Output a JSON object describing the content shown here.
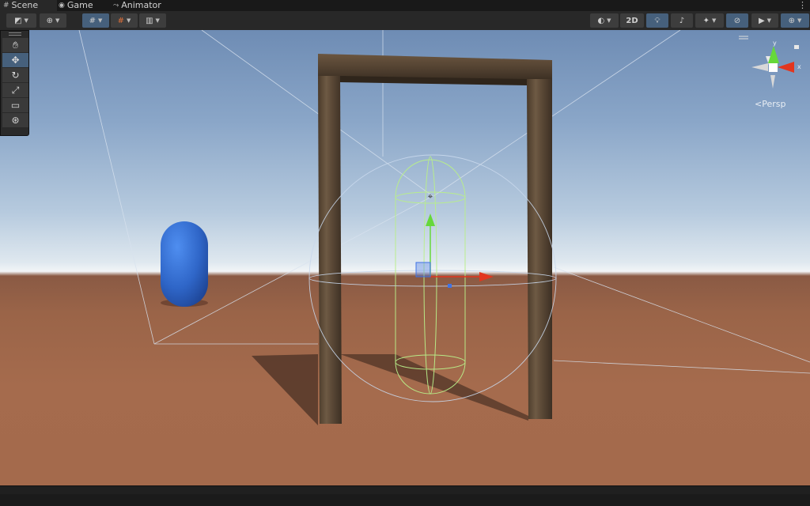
{
  "tabs": [
    {
      "label": "Scene",
      "icon": "grid-hash-icon",
      "active": true
    },
    {
      "label": "Game",
      "icon": "gamepad-icon",
      "active": false
    },
    {
      "label": "Animator",
      "icon": "animator-icon",
      "active": false
    }
  ],
  "toolbar": {
    "two_d_label": "2D"
  },
  "gizmo": {
    "projection_label": "Persp",
    "x_label": "x",
    "y_label": "y"
  },
  "colors": {
    "x_axis": "#e2361f",
    "y_axis": "#66d83a",
    "z_axis": "#3f73e6",
    "capsule": "#2f66c8",
    "toolbar_active": "#46607c"
  }
}
